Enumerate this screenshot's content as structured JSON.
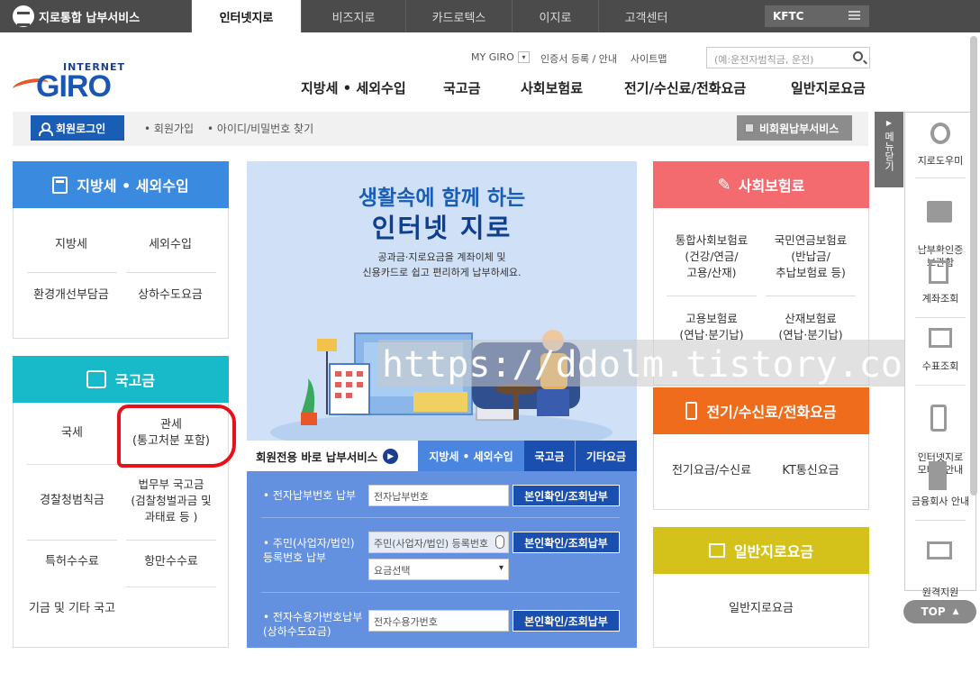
{
  "topbar": {
    "brand": "지로통합 납부서비스",
    "tabs": [
      "인터넷지로",
      "비즈지로",
      "카드로텍스",
      "이지로",
      "고객센터"
    ],
    "kftc": "KFTC"
  },
  "logo": {
    "internet": "INTERNET",
    "giro": "GIRO"
  },
  "utility": {
    "mygiro": "MY GIRO",
    "cert": "인증서 등록 / 안내",
    "sitemap": "사이트맵"
  },
  "search": {
    "placeholder": "(예:운전자범칙금, 운전)"
  },
  "gnb": [
    "지방세 • 세외수입",
    "국고금",
    "사회보험료",
    "전기/수신료/전화요금",
    "일반지로요금"
  ],
  "login": {
    "button": "회원로그인",
    "join": "회원가입",
    "find": "아이디/비밀번호 찾기",
    "nonmember": "비회원납부서비스"
  },
  "local_tax": {
    "title": "지방세 • 세외수입",
    "items": [
      "지방세",
      "세외수입",
      "환경개선부담금",
      "상하수도요금"
    ]
  },
  "national": {
    "title": "국고금",
    "items": [
      "국세",
      "관세\n(통고처분 포함)",
      "경찰청범칙금",
      "법무부 국고금\n(검찰청벌과금 및\n과태료 등 )",
      "특허수수료",
      "항만수수료",
      "기금 및 기타 국고"
    ]
  },
  "banner": {
    "line1": "생활속에 함께 하는",
    "line2": "인터넷 지로",
    "desc1": "공과금·지로요금을 계좌이체 및",
    "desc2": "신용카드로 쉽고 편리하게 납부하세요."
  },
  "shortcut": {
    "label": "회원전용 바로 납부서비스",
    "tabs": [
      "지방세 • 세외수입",
      "국고금",
      "기타요금"
    ]
  },
  "form": {
    "rows": [
      {
        "label": "전자납부번호 납부",
        "input": "전자납부번호",
        "button": "본인확인/조회납부"
      },
      {
        "label": "주민(사업자/법인)\n등록번호 납부",
        "input": "주민(사업자/법인) 등록번호",
        "select": "요금선택",
        "button": "본인확인/조회납부"
      },
      {
        "label": "전자수용가번호납부\n(상하수도요금)",
        "input": "전자수용가번호",
        "button": "본인확인/조회납부"
      }
    ]
  },
  "social": {
    "title": "사회보험료",
    "items": [
      "통합사회보험료\n(건강/연금/\n고용/산재)",
      "국민연금보험료\n(반납금/\n추납보험료 등)",
      "고용보험료\n(연납·분기납)",
      "산재보험료\n(연납·분기납)"
    ]
  },
  "utility_fees": {
    "title": "전기/수신료/전화요금",
    "items": [
      "전기요금/수신료",
      "KT통신요금"
    ]
  },
  "general": {
    "title": "일반지로요금",
    "items": [
      "일반지로요금"
    ]
  },
  "sidebar": {
    "close": "메뉴닫기",
    "items": [
      "지로도우미",
      "납부확인증\n보관함",
      "계좌조회",
      "수표조회",
      "인터넷지로\n모바일안내",
      "금융회사 안내",
      "원격지원\n서비스"
    ],
    "top": "TOP"
  },
  "watermark": "https://ddolm.tistory.com",
  "colors": {
    "blue": "#3a8be0",
    "teal": "#18b9c8",
    "red": "#f36b6f",
    "orange": "#ef6c1c",
    "olive": "#d4c21a",
    "annotation": "#e8111a"
  }
}
